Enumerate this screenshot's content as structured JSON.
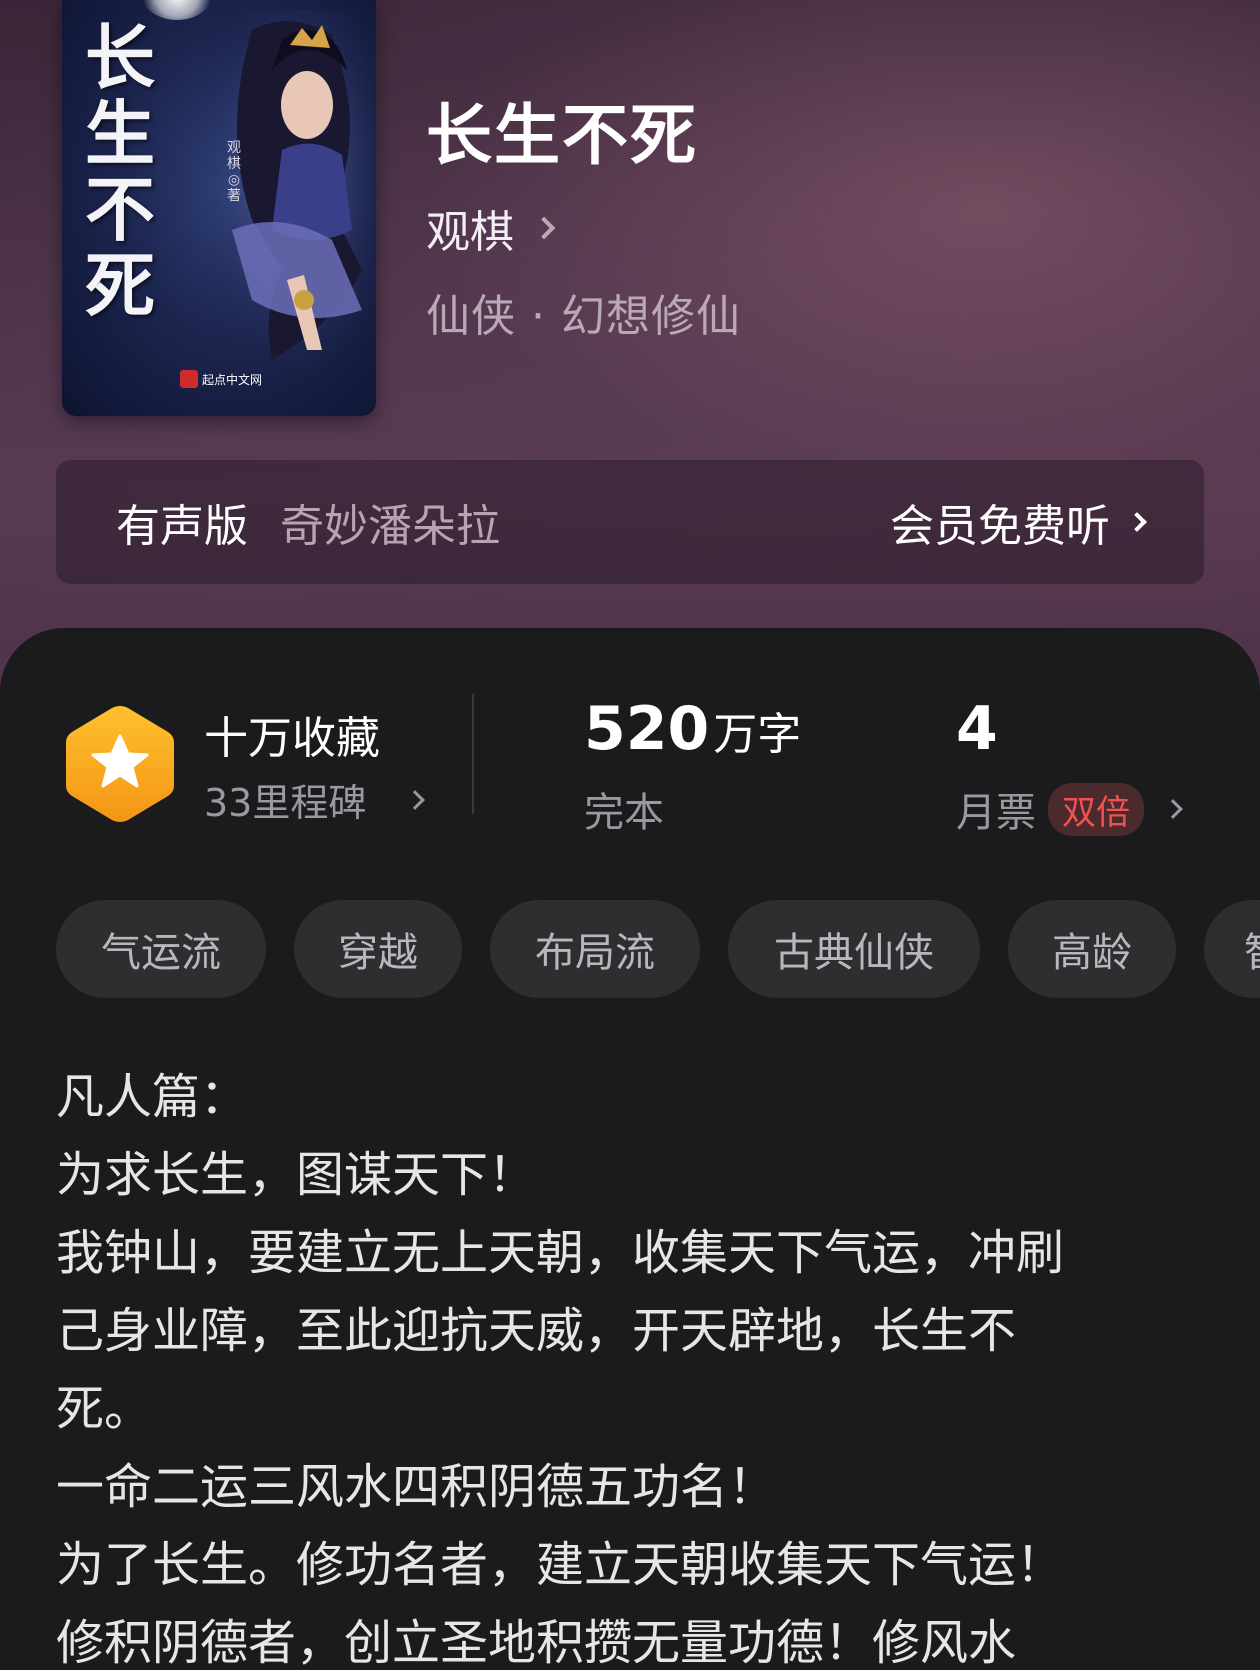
{
  "book": {
    "cover_title": "长生不死",
    "cover_author": "观棋◎著",
    "cover_publisher": "起点中文网",
    "title": "长生不死",
    "author": "观棋",
    "category": "仙侠 · 幻想修仙"
  },
  "audio": {
    "label": "有声版",
    "narrator": "奇妙潘朵拉",
    "free_label": "会员免费听"
  },
  "stats": {
    "favorites_title": "十万收藏",
    "favorites_sub": "33里程碑",
    "words_number": "520",
    "words_unit": "万字",
    "status": "完本",
    "tickets_number": "4",
    "tickets_label": "月票",
    "tickets_badge": "双倍"
  },
  "tags": [
    "气运流",
    "穿越",
    "布局流",
    "古典仙侠",
    "高龄",
    "智"
  ],
  "description": [
    "凡人篇：",
    "为求长生，图谋天下！",
    "我钟山，要建立无上天朝，收集天下气运，冲刷",
    "己身业障，至此迎抗天威，开天辟地，长生不",
    "死。",
    "一命二运三风水四积阴德五功名！",
    "为了长生。修功名者，建立天朝收集天下气运！",
    "修积阴德者，创立圣地积攒无量功德！修风水"
  ],
  "colors": {
    "accent_red": "#f05252",
    "badge_orange": "#f7a51e"
  }
}
